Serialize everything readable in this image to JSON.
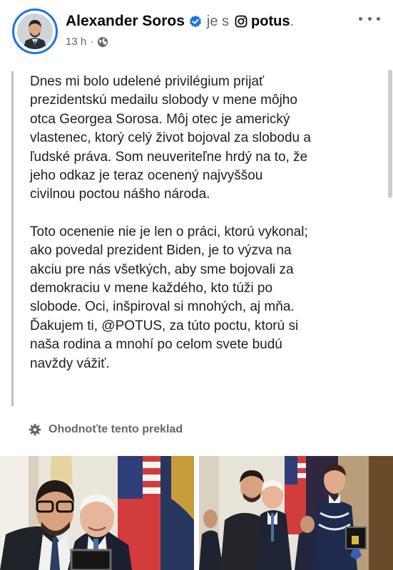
{
  "post": {
    "author": "Alexander Soros",
    "with_text": "je s",
    "tagged_account": "potus",
    "tagged_suffix": ".",
    "time": "13 h",
    "meta_separator": "·",
    "paragraphs": [
      "Dnes mi bolo udelené privilégium prijať\nprezidentskú medailu slobody v mene môjho\notca Georgea Sorosa. Môj otec je americký\nvlastenec, ktorý celý život bojoval za slobodu a\nľudské práva. Som neuveriteľne hrdý na to, že\njeho odkaz je teraz ocenený najvyššou\ncivilnou poctou nášho národa.",
      "Toto ocenenie nie je len o práci, ktorú vykonal;\nako povedal prezident Biden, je to výzva na\nakciu pre nás všetkých, aby sme bojovali za\ndemokraciu v mene každého, kto túži po\nslobode. Oci, inšpiroval si mnohých, aj mňa.\nĎakujem ti, @POTUS, za túto poctu, ktorú si\nnaša rodina a mnohí po celom svete budú\nnavždy vážiť."
    ],
    "translation_prompt": "Ohodnoťte tento preklad"
  },
  "icons": {
    "verified": "verified-badge-icon",
    "instagram": "instagram-icon",
    "globe": "globe-icon",
    "more": "more-options-icon",
    "gear": "gear-icon"
  },
  "colors": {
    "accent": "#1b74e4",
    "secondary_text": "#65676b",
    "primary_text": "#050505"
  }
}
